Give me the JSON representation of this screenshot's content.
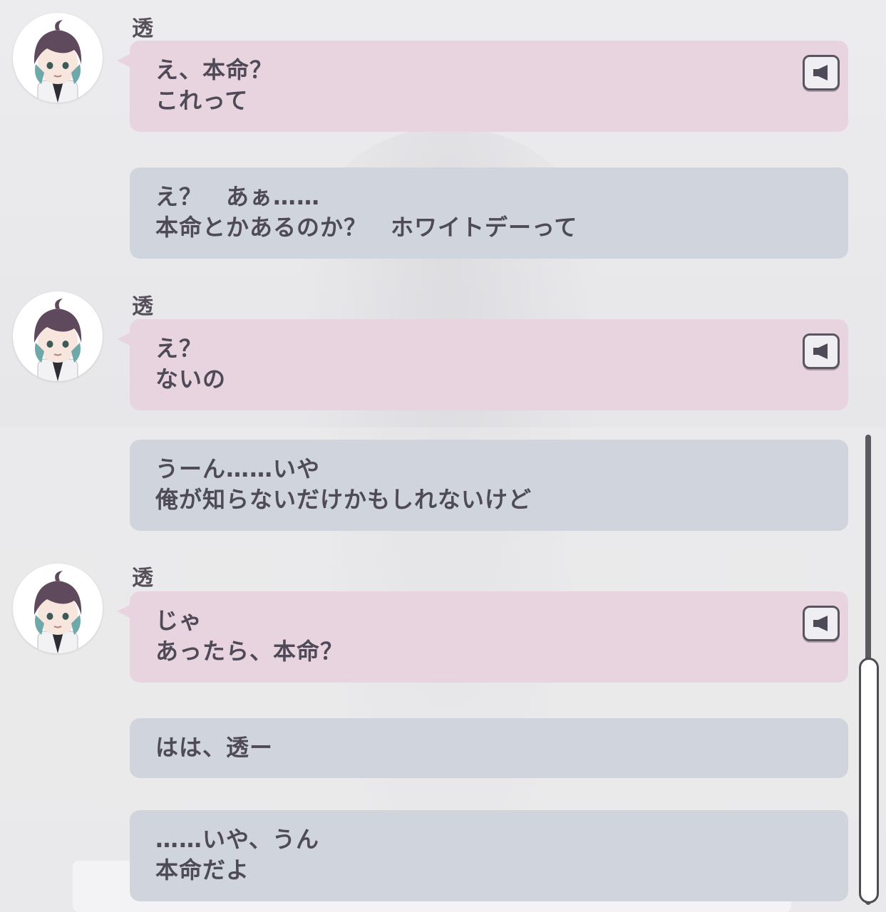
{
  "messages": [
    {
      "speaker": "透",
      "side": "partner",
      "voice_icon": "speaker-icon",
      "lines": [
        "え、本命？",
        "これって"
      ]
    },
    {
      "speaker": "",
      "side": "player",
      "lines": [
        "え？　あぁ……",
        "本命とかあるのか？　ホワイトデーって"
      ]
    },
    {
      "speaker": "透",
      "side": "partner",
      "voice_icon": "speaker-icon",
      "lines": [
        "え？",
        "ないの"
      ]
    },
    {
      "speaker": "",
      "side": "player",
      "lines": [
        "うーん……いや",
        "俺が知らないだけかもしれないけど"
      ]
    },
    {
      "speaker": "透",
      "side": "partner",
      "voice_icon": "speaker-icon",
      "lines": [
        "じゃ",
        "あったら、本命？"
      ]
    },
    {
      "speaker": "",
      "side": "player",
      "lines": [
        "はは、透ー"
      ]
    },
    {
      "speaker": "",
      "side": "player",
      "lines": [
        "……いや、うん",
        "本命だよ"
      ]
    }
  ],
  "colors": {
    "partner_bubble": "#e8d4df",
    "player_bubble": "#d0d5dd",
    "text": "#4e4a58",
    "name": "#56505a"
  },
  "scrollbar": {
    "position": "bottom"
  }
}
